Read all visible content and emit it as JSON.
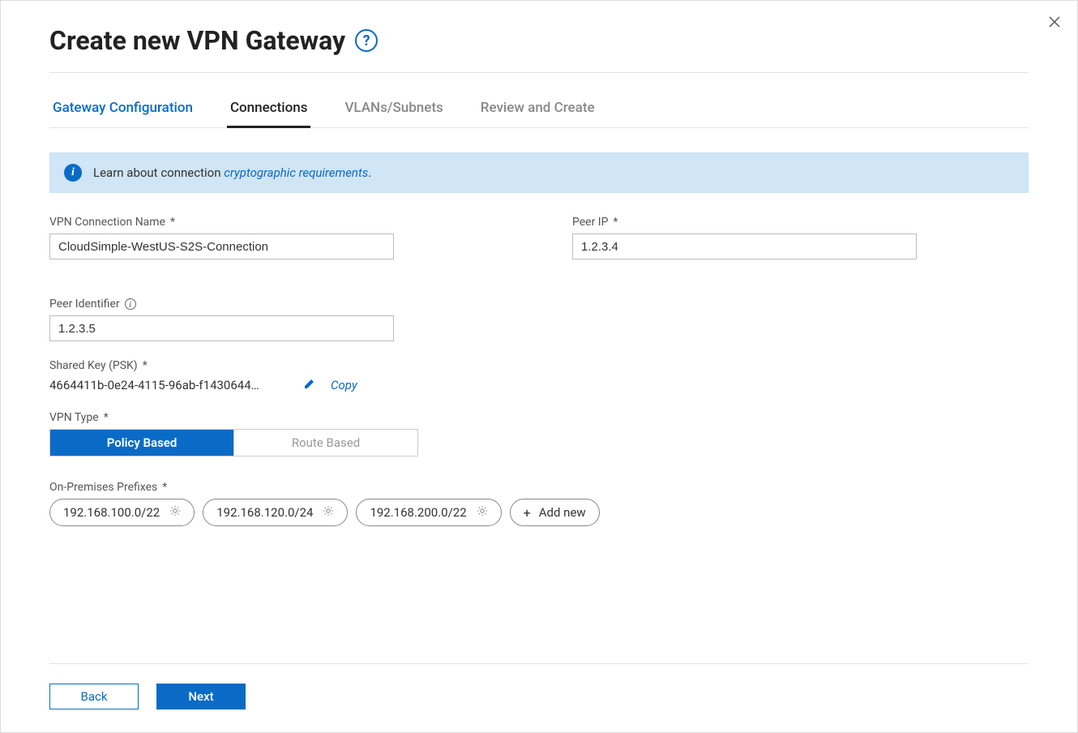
{
  "header": {
    "title": "Create new VPN Gateway"
  },
  "tabs": [
    {
      "label": "Gateway Configuration",
      "state": "done"
    },
    {
      "label": "Connections",
      "state": "active"
    },
    {
      "label": "VLANs/Subnets",
      "state": ""
    },
    {
      "label": "Review and Create",
      "state": ""
    }
  ],
  "banner": {
    "text_before": "Learn about connection ",
    "link_text": "cryptographic requirements",
    "text_after": "."
  },
  "fields": {
    "vpn_connection_name": {
      "label": "VPN Connection Name",
      "required": "*",
      "value": "CloudSimple-WestUS-S2S-Connection"
    },
    "peer_ip": {
      "label": "Peer IP",
      "required": "*",
      "value": "1.2.3.4"
    },
    "peer_identifier": {
      "label": "Peer Identifier",
      "value": "1.2.3.5"
    },
    "shared_key": {
      "label": "Shared Key  (PSK)",
      "required": "*",
      "value": "4664411b-0e24-4115-96ab-f1430644…",
      "copy_label": "Copy"
    },
    "vpn_type": {
      "label": "VPN Type",
      "required": "*",
      "options": [
        {
          "label": "Policy Based",
          "selected": true
        },
        {
          "label": "Route Based",
          "selected": false
        }
      ]
    },
    "on_prem_prefixes": {
      "label": "On-Premises Prefixes",
      "required": "*",
      "prefixes": [
        "192.168.100.0/22",
        "192.168.120.0/24",
        "192.168.200.0/22"
      ],
      "add_label": "Add new"
    }
  },
  "footer": {
    "back": "Back",
    "next": "Next"
  }
}
